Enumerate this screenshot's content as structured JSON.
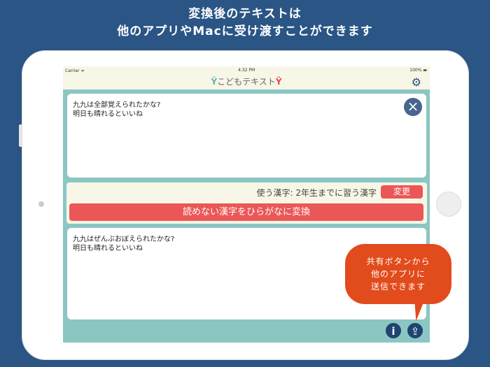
{
  "headline": {
    "line1": "変換後のテキストは",
    "line2": "他のアプリやMacに受け渡すことができます"
  },
  "status": {
    "carrier": "Carrier ᯤ",
    "time": "4:32 PM",
    "battery": "100% ▬"
  },
  "app": {
    "title": "こどもテキスト"
  },
  "input": {
    "line1": "九九は全部覚えられたかな?",
    "line2": "明日も晴れるといいね"
  },
  "controls": {
    "kanji_setting": "使う漢字: 2年生までに習う漢字",
    "change_label": "変更",
    "convert_label": "読めない漢字をひらがなに変換"
  },
  "output": {
    "line1": "九九はぜんぶおぼえられたかな?",
    "line2": "明日も晴れるといいね"
  },
  "callout": {
    "line1": "共有ボタンから",
    "line2": "他のアプリに",
    "line3": "送信できます"
  },
  "colors": {
    "background": "#2a5585",
    "teal": "#8bc6c3",
    "accent": "#eb5757",
    "callout": "#e24b1b"
  }
}
